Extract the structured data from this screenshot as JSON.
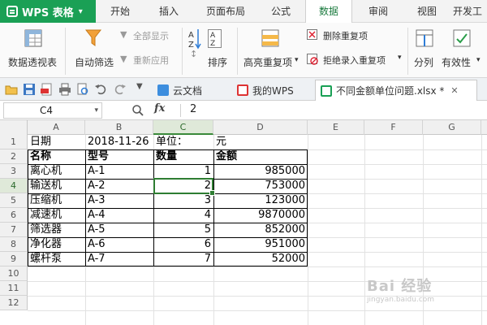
{
  "menubar": {
    "app_name": "WPS 表格",
    "tabs": [
      "开始",
      "插入",
      "页面布局",
      "公式",
      "数据",
      "审阅",
      "视图",
      "开发工"
    ],
    "active_tab": "数据"
  },
  "ribbon": {
    "pivot_table": "数据透视表",
    "auto_filter": "自动筛选",
    "show_all": "全部显示",
    "reapply": "重新应用",
    "sort": "排序",
    "highlight_duplicates": "高亮重复项",
    "remove_duplicates": "删除重复项",
    "reject_duplicates": "拒绝录入重复项",
    "split": "分列",
    "validity": "有效性"
  },
  "doc_tabs": {
    "cloud_docs": "云文档",
    "my_wps": "我的WPS",
    "file": "不同金额单位问题.xlsx *"
  },
  "formula_bar": {
    "cell_ref": "C4",
    "fx": "fx",
    "value": "2"
  },
  "sheet": {
    "columns": [
      "A",
      "B",
      "C",
      "D",
      "E",
      "F",
      "G"
    ],
    "rows": [
      "1",
      "2",
      "3",
      "4",
      "5",
      "6",
      "7",
      "8",
      "9",
      "10",
      "11",
      "12"
    ],
    "selected_column": "C",
    "selected_row": "4",
    "row1": {
      "a": "日期",
      "b": "2018-11-26",
      "c": "单位：",
      "d": "元"
    },
    "header": {
      "a": "名称",
      "b": "型号",
      "c": "数量",
      "d": "金额"
    },
    "data": [
      {
        "name": "离心机",
        "model": "A-1",
        "qty": "1",
        "amount": "985000"
      },
      {
        "name": "输送机",
        "model": "A-2",
        "qty": "2",
        "amount": "753000"
      },
      {
        "name": "压缩机",
        "model": "A-3",
        "qty": "3",
        "amount": "123000"
      },
      {
        "name": "减速机",
        "model": "A-4",
        "qty": "4",
        "amount": "9870000"
      },
      {
        "name": "筛选器",
        "model": "A-5",
        "qty": "5",
        "amount": "852000"
      },
      {
        "name": "净化器",
        "model": "A-6",
        "qty": "6",
        "amount": "951000"
      },
      {
        "name": "螺杆泵",
        "model": "A-7",
        "qty": "7",
        "amount": "52000"
      }
    ]
  },
  "watermark": {
    "text": "Bai 经验",
    "sub": "jingyan.baidu.com"
  },
  "colors": {
    "brand_green": "#1aa055",
    "selection_green": "#2e7d32"
  }
}
